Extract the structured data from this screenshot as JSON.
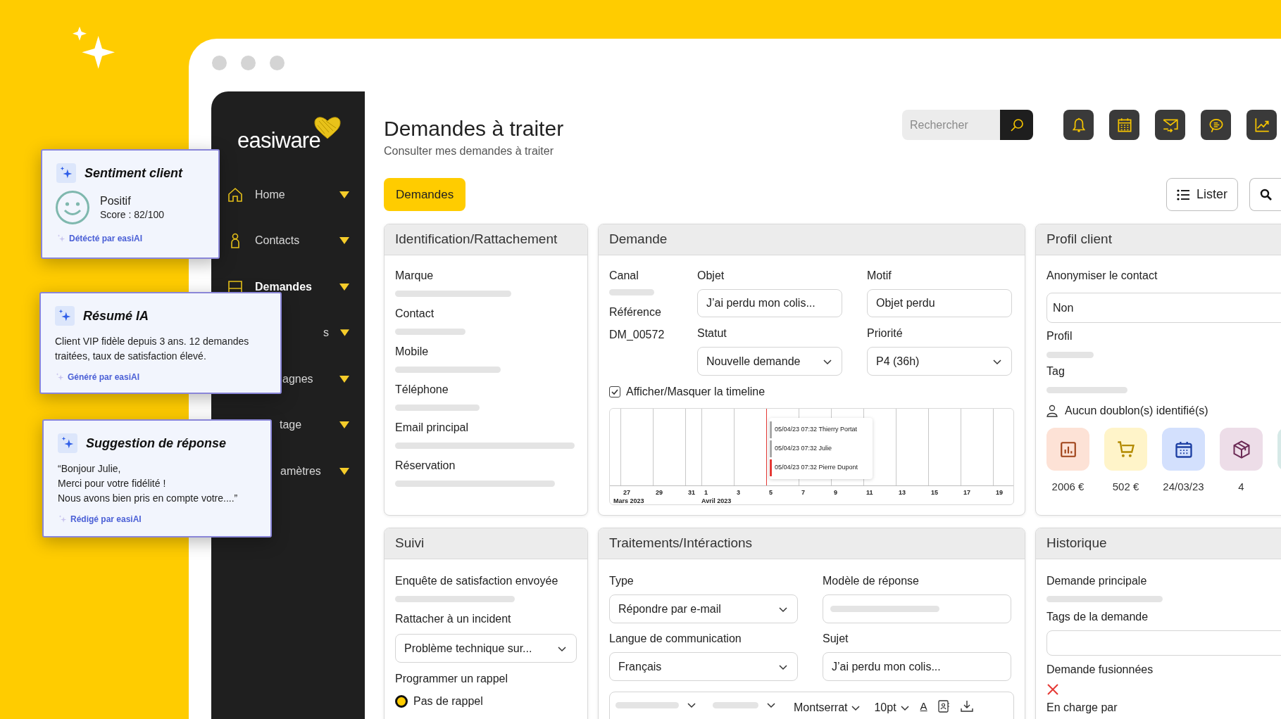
{
  "ai_cards": [
    {
      "kind": "sentiment",
      "title": "Sentiment client",
      "sentiment": "Positif",
      "score": "Score : 82/100",
      "footer": "Détécté par easiAI"
    },
    {
      "kind": "text",
      "title": "Résumé IA",
      "text": "Client VIP fidèle depuis 3 ans. 12 demandes traitées, taux de satisfaction élevé.",
      "footer": "Généré par easiAI"
    },
    {
      "kind": "text",
      "title": "Suggestion de réponse",
      "text": "“Bonjour Julie,\nMerci pour votre fidélité !\nNous avons bien pris en compte votre....”",
      "footer": "Rédigé par easiAI"
    }
  ],
  "sidebar": {
    "logo": "easiware",
    "items": [
      {
        "label": "Home",
        "selected": false
      },
      {
        "label": "Contacts",
        "selected": false
      },
      {
        "label": "Demandes",
        "selected": true
      },
      {
        "label": "s",
        "selected": false
      },
      {
        "label": "agnes",
        "selected": false
      },
      {
        "label": "tage",
        "selected": false
      },
      {
        "label": "amètres",
        "selected": false
      }
    ]
  },
  "header": {
    "title": "Demandes à traiter",
    "subtitle": "Consulter mes demandes à traiter",
    "search": {
      "placeholder": "Rechercher"
    }
  },
  "tabs": [
    {
      "label": "Demandes",
      "selected": true
    }
  ],
  "list_button": "Lister",
  "identification": {
    "title": "Identification/Rattachement",
    "fields": [
      "Marque",
      "Contact",
      "Mobile",
      "Téléphone",
      "Email principal",
      "Réservation"
    ]
  },
  "demande": {
    "title": "Demande",
    "canal": "Canal",
    "reference_label": "Référence",
    "reference": "DM_00572",
    "objet": {
      "label": "Objet",
      "value": "J’ai perdu mon colis..."
    },
    "motif": {
      "label": "Motif",
      "value": "Objet perdu"
    },
    "statut": {
      "label": "Statut",
      "value": "Nouvelle demande"
    },
    "priorite": {
      "label": "Priorité",
      "value": "P4 (36h)"
    },
    "timeline_toggle": {
      "label": "Afficher/Masquer la timeline",
      "checked": true
    },
    "timeline": {
      "ticks": [
        {
          "label": "27",
          "today": false
        },
        {
          "label": "29",
          "today": false
        },
        {
          "label": "31",
          "today": false
        },
        {
          "label": "1",
          "today": false
        },
        {
          "label": "3",
          "today": false
        },
        {
          "label": "5",
          "today": true
        },
        {
          "label": "7",
          "today": false
        },
        {
          "label": "9",
          "today": false
        },
        {
          "label": "11",
          "today": false
        },
        {
          "label": "13",
          "today": false
        },
        {
          "label": "15",
          "today": false
        },
        {
          "label": "17",
          "today": false
        },
        {
          "label": "19",
          "today": false
        }
      ],
      "months": [
        "Mars 2023",
        "Avril 2023"
      ],
      "events": [
        {
          "text": "05/04/23 07:32 Thierry Portat",
          "color": "#a8a8a8"
        },
        {
          "text": "05/04/23 07:32 Julie",
          "color": "#a8a8a8"
        },
        {
          "text": "05/04/23 07:32 Pierre Dupont",
          "color": "#e53935"
        }
      ]
    }
  },
  "profil": {
    "title": "Profil client",
    "anonymize": {
      "label": "Anonymiser le contact",
      "value": "Non"
    },
    "fields": [
      "Profil",
      "Tag"
    ],
    "duplicates": "Aucun doublon(s) identifié(s)",
    "stats": [
      {
        "value": "2006 €",
        "color": "#fde2d6"
      },
      {
        "value": "502 €",
        "color": "#fff4c9"
      },
      {
        "value": "24/03/23",
        "color": "#d3e0fd"
      },
      {
        "value": "4",
        "color": "#eddde8"
      },
      {
        "color": "#d6e9e7"
      }
    ]
  },
  "suivi": {
    "title": "Suivi",
    "survey": "Enquête de satisfaction envoyée",
    "incident": {
      "label": "Rattacher à un incident",
      "value": "Problème technique sur..."
    },
    "reminder": {
      "label": "Programmer un rappel",
      "options": [
        {
          "label": "Pas de rappel",
          "selected": true
        }
      ]
    }
  },
  "traitements": {
    "title": "Traitements/Intéractions",
    "type": {
      "label": "Type",
      "value": "Répondre par e-mail"
    },
    "template": {
      "label": "Modèle de réponse"
    },
    "language": {
      "label": "Langue de communication",
      "value": "Français"
    },
    "subject": {
      "label": "Sujet",
      "value": "J’ai perdu mon colis..."
    },
    "editor": {
      "font": "Montserrat",
      "size": "10pt",
      "color_glyph": "A"
    }
  },
  "historique": {
    "title": "Historique",
    "fields": [
      {
        "label": "Demande principale",
        "kind": "bar"
      },
      {
        "label": "Tags de la demande",
        "kind": "field"
      },
      {
        "label": "Demande fusionnées",
        "kind": "cross"
      },
      {
        "label": "En charge par",
        "kind": "empty"
      }
    ]
  }
}
